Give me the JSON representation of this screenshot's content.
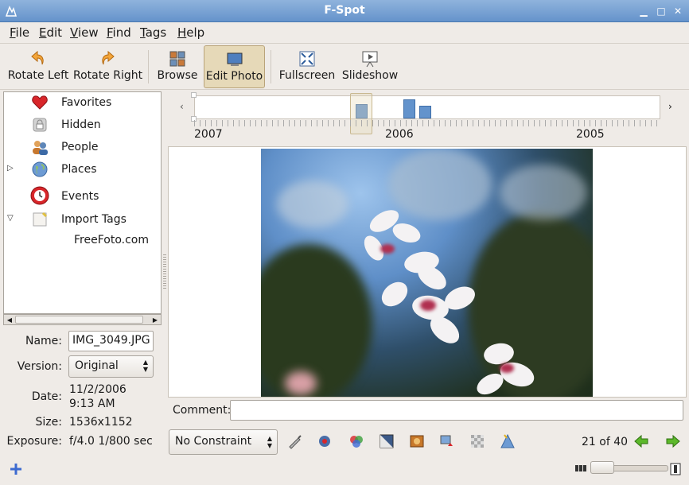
{
  "window": {
    "title": "F-Spot"
  },
  "menu": [
    "File",
    "Edit",
    "View",
    "Find",
    "Tags",
    "Help"
  ],
  "toolbar": {
    "rotate_left": "Rotate Left",
    "rotate_right": "Rotate Right",
    "browse": "Browse",
    "edit_photo": "Edit Photo",
    "fullscreen": "Fullscreen",
    "slideshow": "Slideshow"
  },
  "tags": [
    {
      "label": "Favorites",
      "icon": "heart-icon"
    },
    {
      "label": "Hidden",
      "icon": "lock-icon"
    },
    {
      "label": "People",
      "icon": "people-icon"
    },
    {
      "label": "Places",
      "icon": "globe-icon"
    },
    {
      "label": "Events",
      "icon": "clock-icon"
    },
    {
      "label": "Import Tags",
      "icon": "import-tag-icon"
    },
    {
      "label": "FreeFoto.com",
      "icon": ""
    }
  ],
  "info": {
    "name_label": "Name:",
    "name_value": "IMG_3049.JPG",
    "version_label": "Version:",
    "version_value": "Original",
    "date_label": "Date:",
    "date_line1": "11/2/2006",
    "date_line2": "9:13 AM",
    "size_label": "Size:",
    "size_value": "1536x1152",
    "exposure_label": "Exposure:",
    "exposure_value": "f/4.0 1/800 sec"
  },
  "timeline": {
    "years": [
      "2007",
      "2006",
      "2005"
    ]
  },
  "comment": {
    "label": "Comment:",
    "value": ""
  },
  "constraint": {
    "value": "No Constraint"
  },
  "photo_counter": "21 of 40",
  "colors": {
    "accent": "#6593cb",
    "active_button": "#e6d9b8",
    "nav_arrow": "#3a9a1a"
  }
}
